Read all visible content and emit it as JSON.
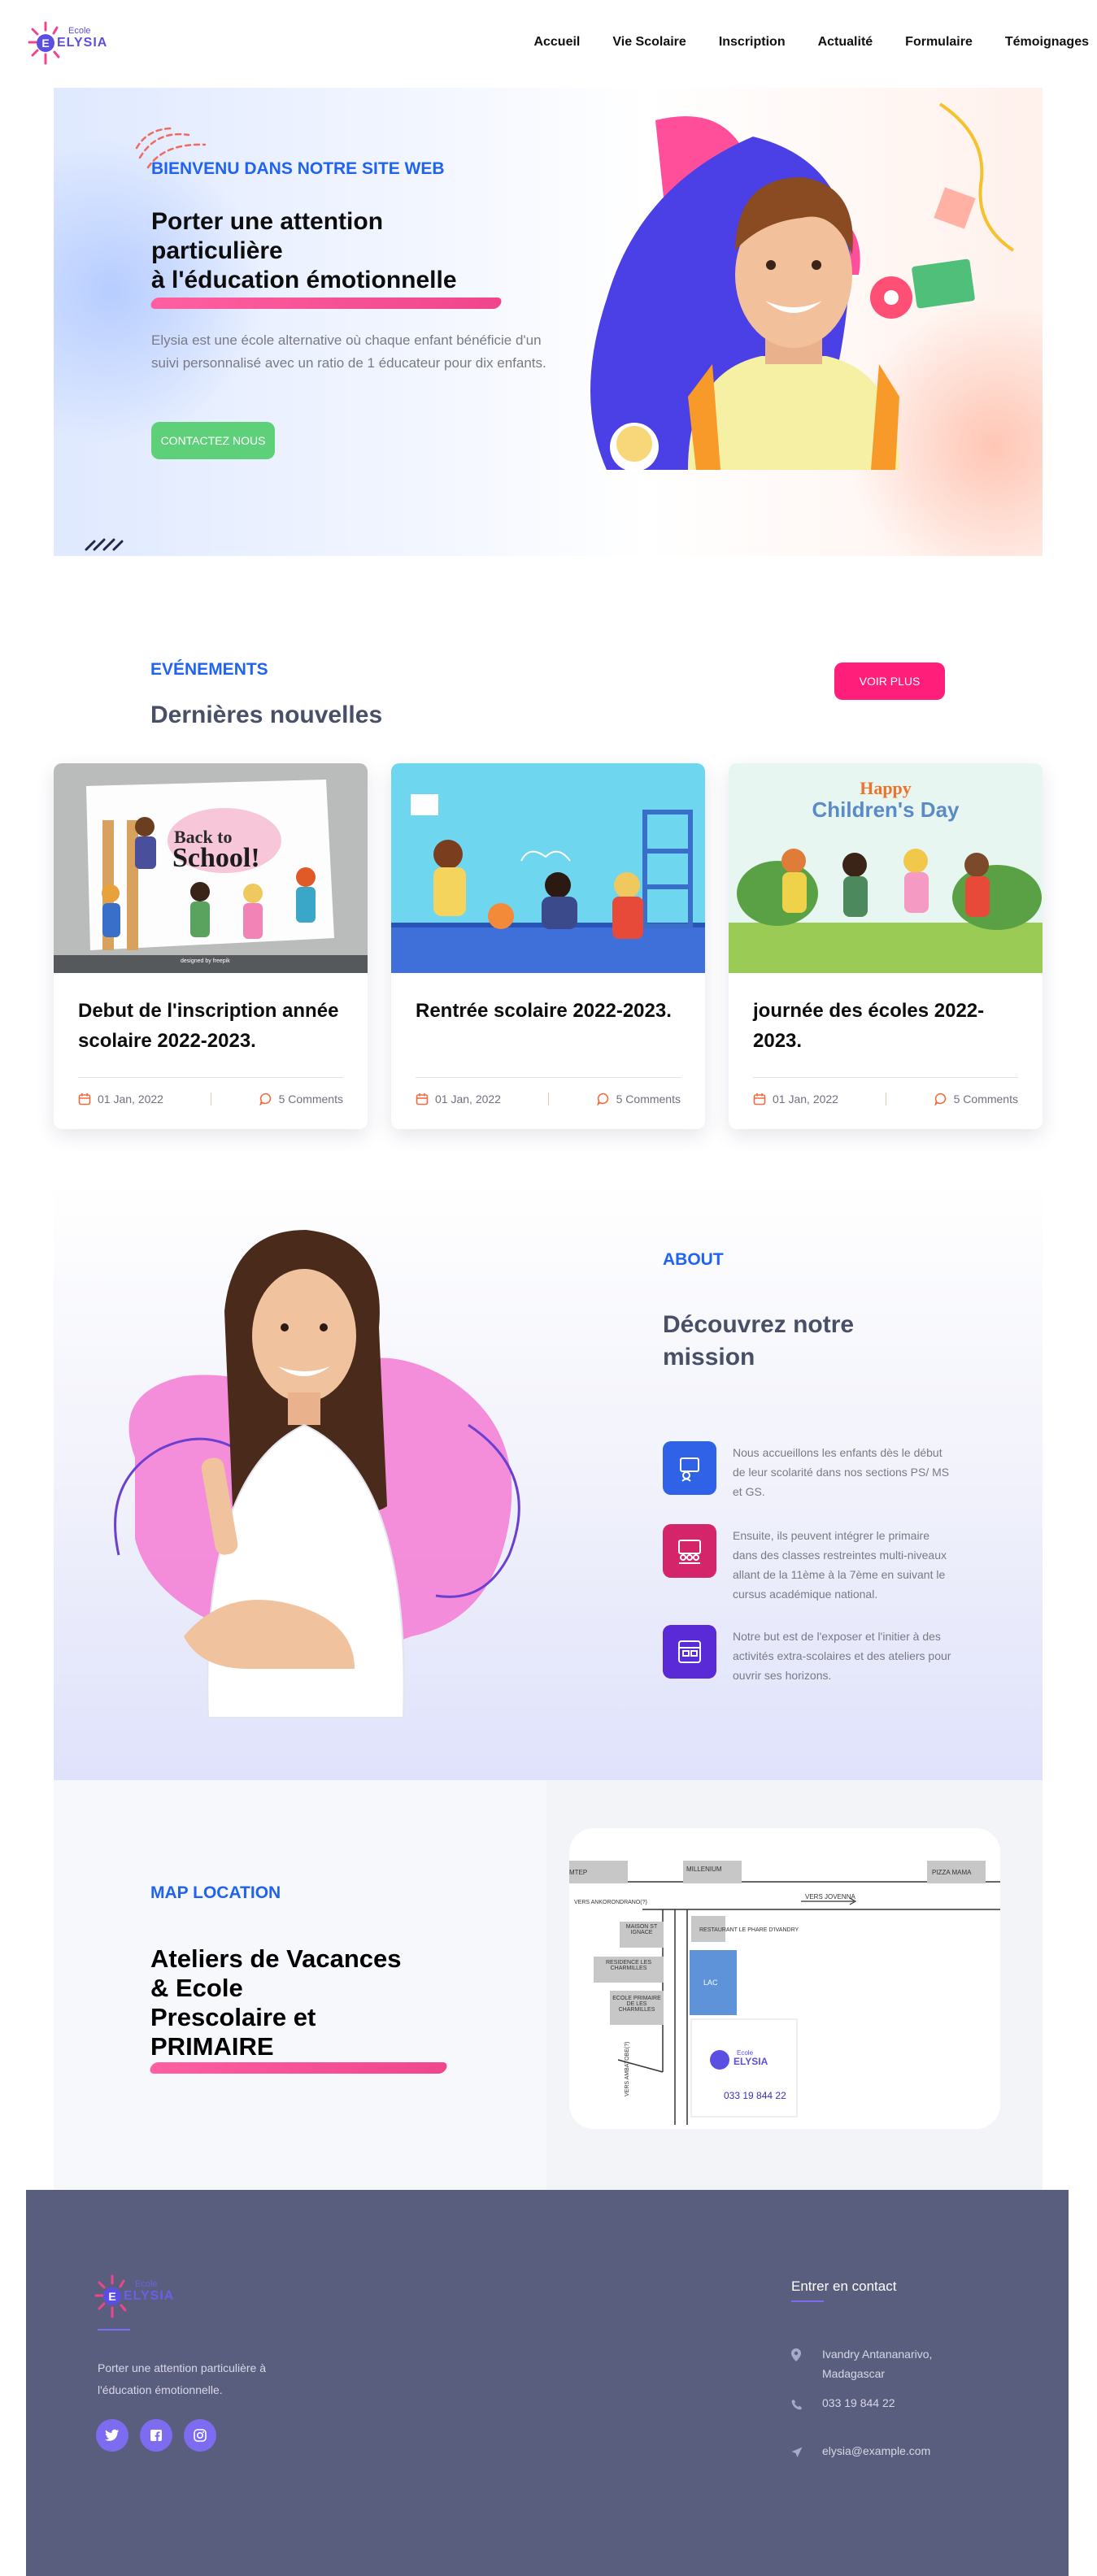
{
  "header": {
    "logo_small": "Ecole",
    "logo_big": "ELYSIA",
    "nav": [
      "Accueil",
      "Vie Scolaire",
      "Inscription",
      "Actualité",
      "Formulaire",
      "Témoignages"
    ]
  },
  "hero": {
    "kicker": "BIENVENU DANS NOTRE SITE WEB",
    "title_lines": [
      "Porter une attention",
      "particulière",
      "à l'éducation émotionnelle"
    ],
    "description": "Elysia est une école alternative où chaque enfant bénéficie d'un suivi personnalisé avec un ratio de 1 éducateur pour dix enfants.",
    "cta": "CONTACTEZ NOUS"
  },
  "events": {
    "kicker": "EVÉNEMENTS",
    "title": "Dernières nouvelles",
    "more_button": "VOIR PLUS",
    "cards": [
      {
        "title": "Debut de l'inscription année scolaire 2022-2023.",
        "date": "01 Jan, 2022",
        "comments": "5 Comments",
        "poster_line1": "Back to",
        "poster_line2": "School!",
        "credit": "designed by freepik"
      },
      {
        "title": "Rentrée scolaire 2022-2023.",
        "date": "01 Jan, 2022",
        "comments": "5 Comments"
      },
      {
        "title": "journée des écoles 2022-2023.",
        "date": "01 Jan, 2022",
        "comments": "5 Comments",
        "poster_line1": "Happy",
        "poster_line2": "Children's Day"
      }
    ]
  },
  "about": {
    "kicker": "ABOUT",
    "title": "Découvrez notre mission",
    "features": [
      {
        "text": "Nous accueillons les enfants dès le début de leur scolarité dans nos sections PS/ MS et GS.",
        "color": "#2f62e6"
      },
      {
        "text": "Ensuite, ils peuvent intégrer le primaire dans des classes restreintes multi-niveaux allant de la 11ème à la 7ème en suivant le cursus académique national.",
        "color": "#d4246a"
      },
      {
        "text": "Notre but est de l'exposer et l'initier à des activités extra-scolaires et des ateliers pour ouvrir ses horizons.",
        "color": "#5a2ad6"
      }
    ]
  },
  "map": {
    "kicker": "MAP LOCATION",
    "title_lines": [
      "Ateliers de Vacances",
      "& Ecole",
      "Prescolaire et",
      "PRIMAIRE"
    ],
    "labels": {
      "mtep": "MTEP",
      "millenium": "MILLENIUM",
      "pizza": "PIZZA MAMA",
      "vers_jovenna": "VERS JOVENNA",
      "vers_ankorondrano": "VERS ANKORONDRANO(?)",
      "maison": "MAISON ST IGNACE",
      "restaurant": "RESTAURANT LE PHARE D'IVANDRY",
      "residence": "RESIDENCE LES CHARMILLES",
      "ecole": "ECOLE PRIMAIRE DE LES CHARMILLES",
      "lac": "LAC",
      "road": "VERS AMBATOBE(?)",
      "logo_small": "Ecole",
      "logo_big": "ELYSIA",
      "phone": "033 19 844 22"
    }
  },
  "footer": {
    "logo_small": "Ecole",
    "logo_big": "ELYSIA",
    "description": "Porter une attention particulière à l'éducation émotionnelle.",
    "contact_title": "Entrer en contact",
    "address": "Ivandry Antananarivo, Madagascar",
    "phone": "033 19 844 22",
    "email": "elysia@example.com"
  },
  "colors": {
    "primary_blue": "#1f63f0",
    "pink": "#ff1f7a",
    "green": "#5fd07a",
    "footer_bg": "#5a5e7e",
    "social_purple": "#7d6cf0"
  }
}
